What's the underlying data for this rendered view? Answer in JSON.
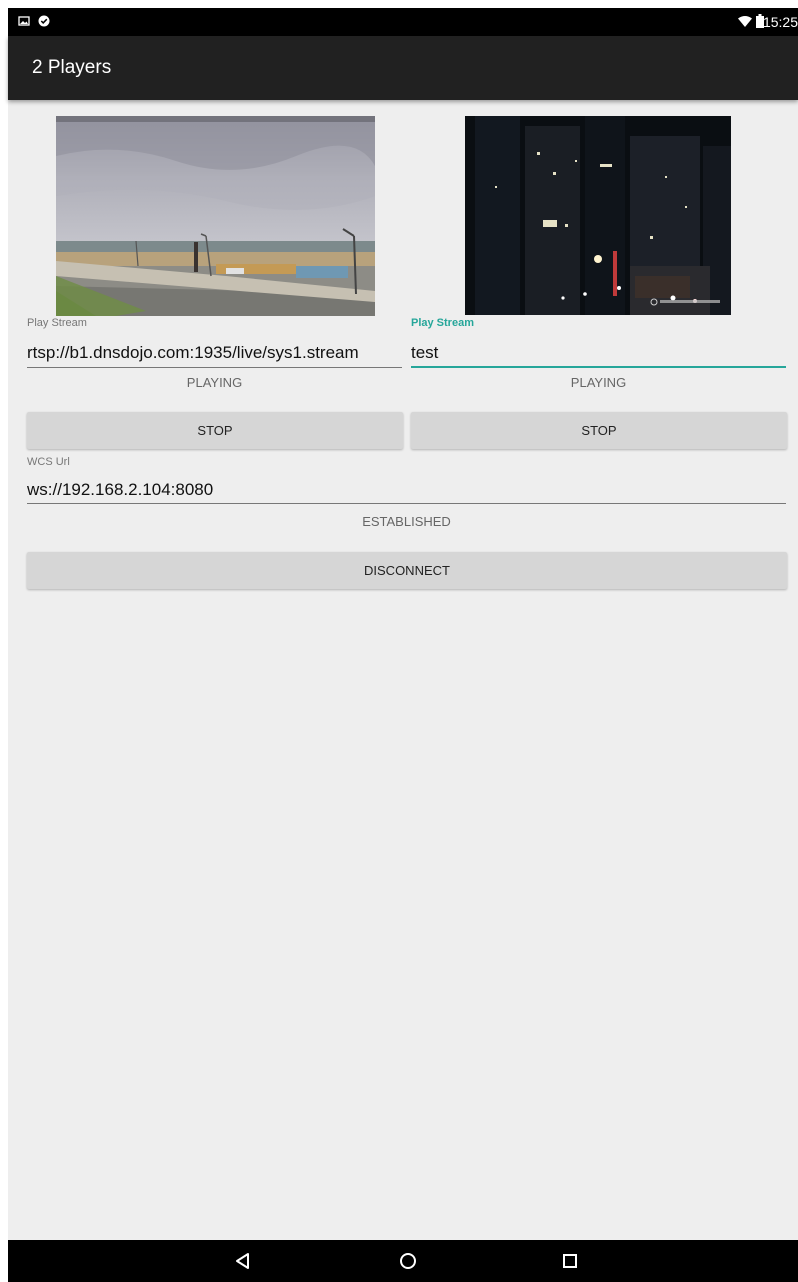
{
  "status_bar": {
    "time": "15:25",
    "icons": [
      "image-icon",
      "check-circle-icon",
      "wifi-icon",
      "battery-icon"
    ]
  },
  "app_bar": {
    "title": "2 Players"
  },
  "players": [
    {
      "label": "Play Stream",
      "url": "rtsp://b1.dnsdojo.com:1935/live/sys1.stream",
      "status": "PLAYING",
      "button": "STOP"
    },
    {
      "label": "Play Stream",
      "url": "test",
      "status": "PLAYING",
      "button": "STOP"
    }
  ],
  "wcs": {
    "label": "WCS Url",
    "url": "ws://192.168.2.104:8080",
    "status": "ESTABLISHED",
    "button": "DISCONNECT"
  },
  "nav_bar": {
    "icons": [
      "back-icon",
      "home-icon",
      "recents-icon"
    ]
  },
  "colors": {
    "accent": "#26a69a",
    "appbar": "#212121",
    "background": "#eeeeee"
  }
}
